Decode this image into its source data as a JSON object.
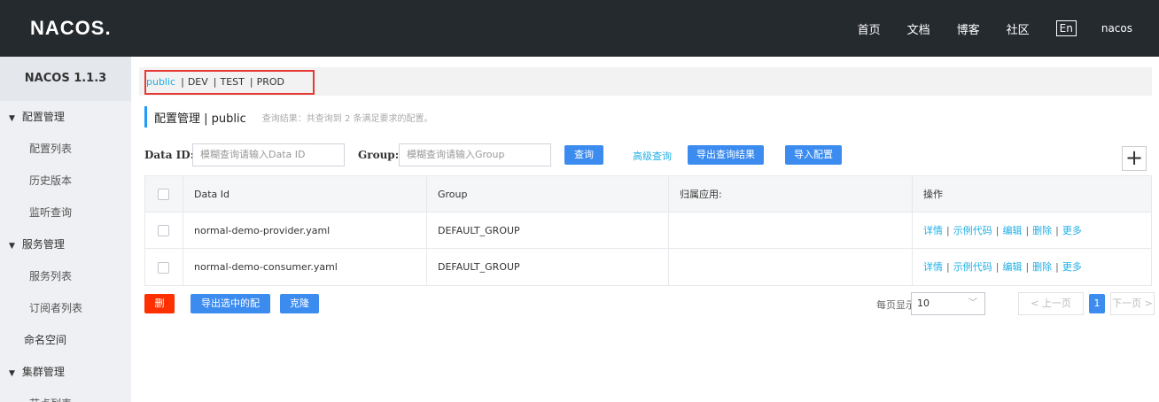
{
  "app": {
    "logo": "NACOS."
  },
  "topnav": {
    "items": [
      "首页",
      "文档",
      "博客",
      "社区"
    ],
    "lang": "En",
    "user": "nacos"
  },
  "sidebar": {
    "version": "NACOS 1.1.3",
    "groups": [
      {
        "label": "配置管理",
        "items": [
          "配置列表",
          "历史版本",
          "监听查询"
        ]
      },
      {
        "label": "服务管理",
        "items": [
          "服务列表",
          "订阅者列表"
        ]
      },
      {
        "label": "命名空间"
      },
      {
        "label": "集群管理",
        "items": [
          "节点列表"
        ]
      }
    ]
  },
  "namespaces": {
    "items": [
      "public",
      "DEV",
      "TEST",
      "PROD"
    ],
    "active": "public"
  },
  "page": {
    "title": "配置管理 | public",
    "result_text": "查询结果：共查询到 2 条满足要求的配置。"
  },
  "filters": {
    "dataid_label": "Data ID:",
    "dataid_placeholder": "模糊查询请输入Data ID",
    "group_label": "Group:",
    "group_placeholder": "模糊查询请输入Group",
    "query_button": "查询",
    "advanced_link": "高级查询",
    "export_button": "导出查询结果",
    "import_button": "导入配置",
    "add_icon": "+"
  },
  "table": {
    "headers": [
      "Data Id",
      "Group",
      "归属应用:",
      "操作"
    ],
    "rows": [
      {
        "data_id": "normal-demo-provider.yaml",
        "group": "DEFAULT_GROUP",
        "app": ""
      },
      {
        "data_id": "normal-demo-consumer.yaml",
        "group": "DEFAULT_GROUP",
        "app": ""
      }
    ],
    "ops": [
      "详情",
      "示例代码",
      "编辑",
      "删除",
      "更多"
    ]
  },
  "bottom": {
    "delete_button": "删除",
    "export_selected_button": "导出选中的配置",
    "clone_button": "克隆",
    "page_size_label": "每页显示:",
    "page_size": "10",
    "prev": "< 上一页",
    "current_page": "1",
    "next": "下一页 >"
  },
  "colors": {
    "topbar": "#252a2f",
    "primary": "#3c8cf0",
    "link": "#1fb0e6",
    "danger": "#ff3000",
    "highlight_box": "#e53935"
  }
}
